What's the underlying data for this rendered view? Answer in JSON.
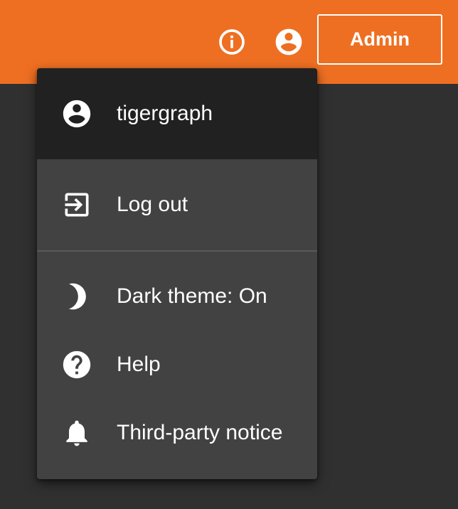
{
  "colors": {
    "toolbar": "#ee6f22",
    "background": "#303030",
    "menu": "#424242",
    "menu_header": "#212121",
    "text": "#ffffff"
  },
  "toolbar": {
    "info_icon": "info-icon",
    "account_icon": "account-circle-icon",
    "admin_label": "Admin"
  },
  "menu": {
    "user": {
      "icon": "account-circle-icon",
      "label": "tigergraph"
    },
    "items": [
      {
        "icon": "logout-icon",
        "label": "Log out"
      },
      {
        "icon": "moon-icon",
        "label": "Dark theme: On"
      },
      {
        "icon": "help-icon",
        "label": "Help"
      },
      {
        "icon": "bell-icon",
        "label": "Third-party notice"
      }
    ]
  }
}
